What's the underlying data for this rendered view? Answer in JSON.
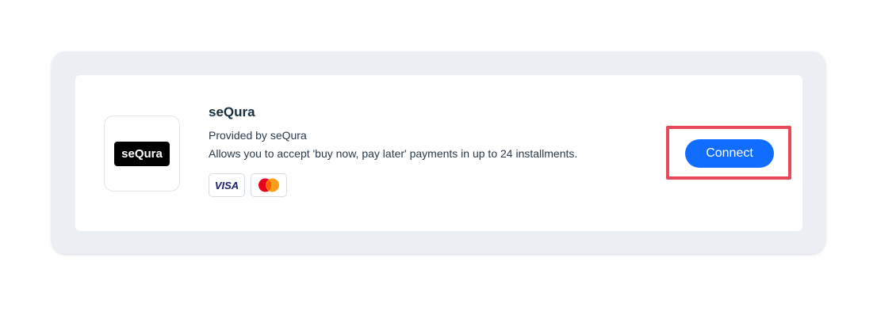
{
  "provider": {
    "title": "seQura",
    "logo_text": "seQura",
    "provided_by": "Provided by seQura",
    "description": "Allows you to accept 'buy now, pay later' payments in up to 24 installments."
  },
  "payment_methods": [
    {
      "name": "visa-icon",
      "label": "VISA"
    },
    {
      "name": "mastercard-icon"
    }
  ],
  "actions": {
    "connect_label": "Connect"
  },
  "colors": {
    "accent": "#116dff",
    "highlight": "#e8495a",
    "panel_bg": "#ebeef2"
  }
}
